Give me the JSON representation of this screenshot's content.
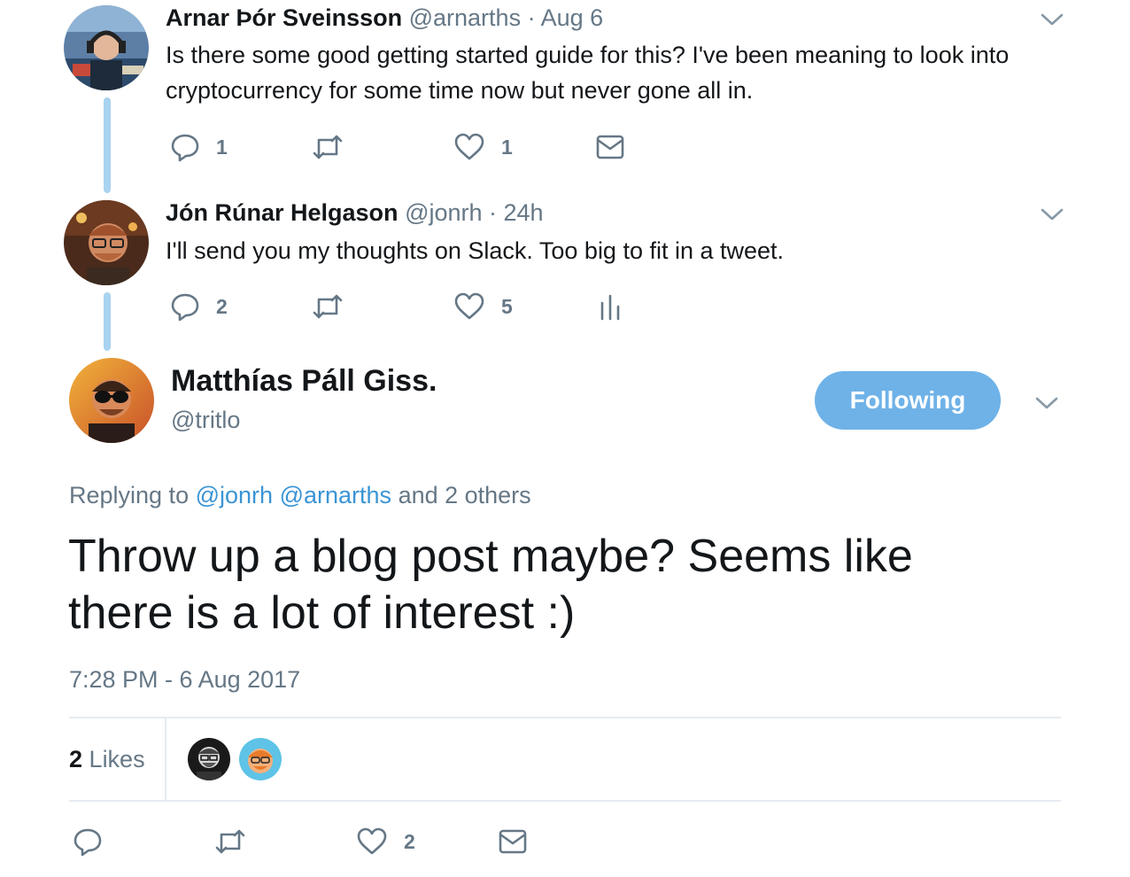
{
  "tweets": [
    {
      "name": "Arnar Þór Sveinsson",
      "handle": "@arnarths",
      "time": "· Aug 6",
      "text": "Is there some good getting started guide for this? I've been meaning to look into cryptocurrency for some time now but never gone all in.",
      "reply_count": "1",
      "like_count": "1"
    },
    {
      "name": "Jón Rúnar Helgason",
      "handle": "@jonrh",
      "time": "· 24h",
      "text": "I'll send you my thoughts on Slack. Too big to fit in a tweet.",
      "reply_count": "2",
      "like_count": "5"
    }
  ],
  "main": {
    "name": "Matthías Páll Giss.",
    "handle": "@tritlo",
    "follow_label": "Following",
    "replying_prefix": "Replying to",
    "replying_mentions": [
      "@jonrh",
      "@arnarths"
    ],
    "replying_suffix": "and 2 others",
    "text": "Throw up a blog post maybe? Seems like there is a lot of interest :)",
    "timestamp": "7:28 PM - 6 Aug 2017",
    "likes_count": "2",
    "likes_label": "Likes",
    "action_like_count": "2"
  },
  "colors": {
    "accent": "#1da1f2",
    "following_button": "#6eb2e8",
    "thread_line": "#a9d3f0",
    "muted_text": "#657786"
  }
}
